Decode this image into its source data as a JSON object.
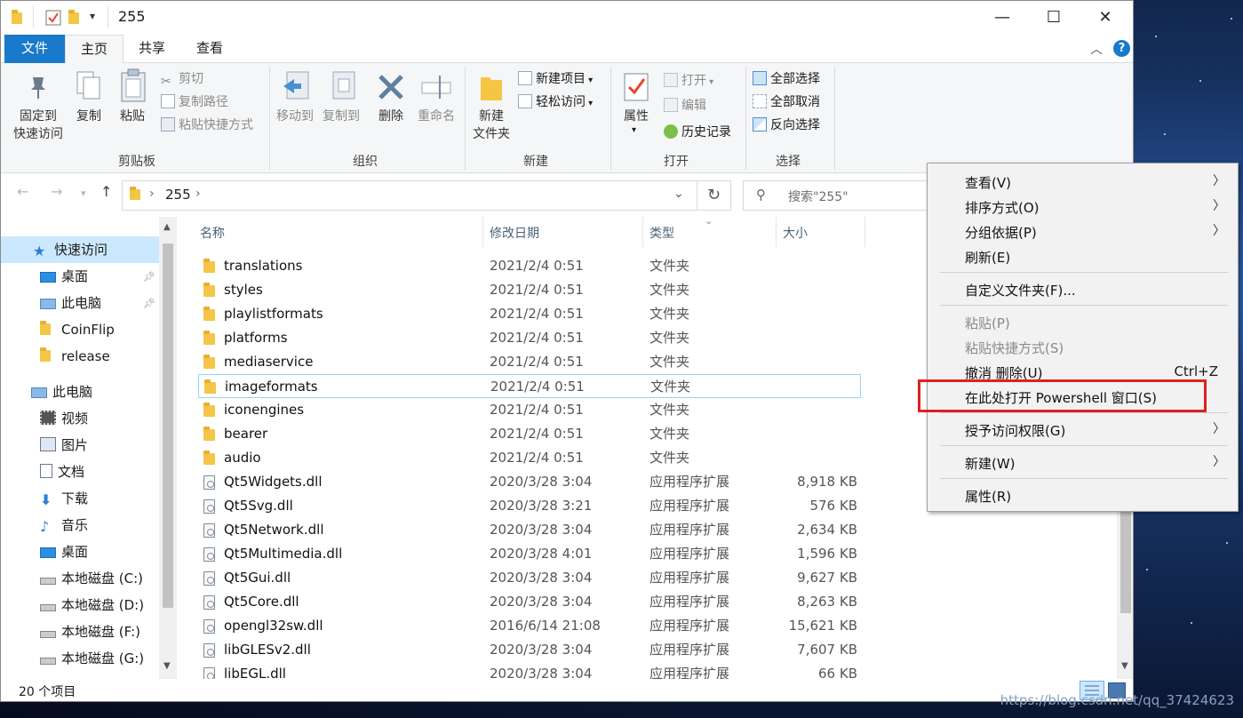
{
  "window": {
    "title": "255",
    "controls": {
      "minimize": "—",
      "maximize": "☐",
      "close": "✕"
    }
  },
  "ribbon": {
    "tabs": [
      "文件",
      "主页",
      "共享",
      "查看"
    ],
    "help_glyph": "?",
    "groups": {
      "clipboard": {
        "label": "剪贴板",
        "pin_label_1": "固定到",
        "pin_label_2": "快速访问",
        "copy_label": "复制",
        "paste_label": "粘贴",
        "cut_label": "剪切",
        "copy_path_label": "复制路径",
        "paste_shortcut_label": "粘贴快捷方式"
      },
      "organize": {
        "label": "组织",
        "move_to_label": "移动到",
        "copy_to_label": "复制到",
        "delete_label": "删除",
        "rename_label": "重命名"
      },
      "new": {
        "label": "新建",
        "new_folder_label_1": "新建",
        "new_folder_label_2": "文件夹",
        "new_item_label": "新建项目",
        "easy_access_label": "轻松访问"
      },
      "open": {
        "label": "打开",
        "properties_label": "属性",
        "open_label": "打开",
        "edit_label": "编辑",
        "history_label": "历史记录"
      },
      "select": {
        "label": "选择",
        "select_all_label": "全部选择",
        "select_none_label": "全部取消",
        "invert_label": "反向选择"
      }
    }
  },
  "address": {
    "path": [
      "255"
    ],
    "search_placeholder": "搜索\"255\""
  },
  "nav": {
    "items": [
      {
        "label": "快速访问",
        "icon": "star-icon"
      },
      {
        "label": "桌面",
        "icon": "desktop-icon"
      },
      {
        "label": "此电脑",
        "icon": "computer-icon"
      },
      {
        "label": "CoinFlip",
        "icon": "folder-icon"
      },
      {
        "label": "release",
        "icon": "folder-icon"
      },
      {
        "label": "此电脑",
        "icon": "computer-icon"
      },
      {
        "label": "视频",
        "icon": "video-icon"
      },
      {
        "label": "图片",
        "icon": "picture-icon"
      },
      {
        "label": "文档",
        "icon": "document-icon"
      },
      {
        "label": "下载",
        "icon": "download-icon"
      },
      {
        "label": "音乐",
        "icon": "music-icon"
      },
      {
        "label": "桌面",
        "icon": "desktop-icon"
      },
      {
        "label": "本地磁盘 (C:)",
        "icon": "drive-icon"
      },
      {
        "label": "本地磁盘 (D:)",
        "icon": "drive-icon"
      },
      {
        "label": "本地磁盘 (F:)",
        "icon": "drive-icon"
      },
      {
        "label": "本地磁盘 (G:)",
        "icon": "drive-icon"
      }
    ]
  },
  "list": {
    "columns": [
      "名称",
      "修改日期",
      "类型",
      "大小"
    ],
    "rows": [
      {
        "name": "translations",
        "date": "2021/2/4 0:51",
        "type": "文件夹",
        "size": ""
      },
      {
        "name": "styles",
        "date": "2021/2/4 0:51",
        "type": "文件夹",
        "size": ""
      },
      {
        "name": "playlistformats",
        "date": "2021/2/4 0:51",
        "type": "文件夹",
        "size": ""
      },
      {
        "name": "platforms",
        "date": "2021/2/4 0:51",
        "type": "文件夹",
        "size": ""
      },
      {
        "name": "mediaservice",
        "date": "2021/2/4 0:51",
        "type": "文件夹",
        "size": ""
      },
      {
        "name": "imageformats",
        "date": "2021/2/4 0:51",
        "type": "文件夹",
        "size": ""
      },
      {
        "name": "iconengines",
        "date": "2021/2/4 0:51",
        "type": "文件夹",
        "size": ""
      },
      {
        "name": "bearer",
        "date": "2021/2/4 0:51",
        "type": "文件夹",
        "size": ""
      },
      {
        "name": "audio",
        "date": "2021/2/4 0:51",
        "type": "文件夹",
        "size": ""
      },
      {
        "name": "Qt5Widgets.dll",
        "date": "2020/3/28 3:04",
        "type": "应用程序扩展",
        "size": "8,918 KB"
      },
      {
        "name": "Qt5Svg.dll",
        "date": "2020/3/28 3:21",
        "type": "应用程序扩展",
        "size": "576 KB"
      },
      {
        "name": "Qt5Network.dll",
        "date": "2020/3/28 3:04",
        "type": "应用程序扩展",
        "size": "2,634 KB"
      },
      {
        "name": "Qt5Multimedia.dll",
        "date": "2020/3/28 4:01",
        "type": "应用程序扩展",
        "size": "1,596 KB"
      },
      {
        "name": "Qt5Gui.dll",
        "date": "2020/3/28 3:04",
        "type": "应用程序扩展",
        "size": "9,627 KB"
      },
      {
        "name": "Qt5Core.dll",
        "date": "2020/3/28 3:04",
        "type": "应用程序扩展",
        "size": "8,263 KB"
      },
      {
        "name": "opengl32sw.dll",
        "date": "2016/6/14 21:08",
        "type": "应用程序扩展",
        "size": "15,621 KB"
      },
      {
        "name": "libGLESv2.dll",
        "date": "2020/3/28 3:04",
        "type": "应用程序扩展",
        "size": "7,607 KB"
      },
      {
        "name": "libEGL.dll",
        "date": "2020/3/28 3:04",
        "type": "应用程序扩展",
        "size": "66 KB"
      }
    ],
    "selected_index": 5
  },
  "status": {
    "count": "20 个项目"
  },
  "context_menu": {
    "items": [
      {
        "label": "查看(V)",
        "submenu": true,
        "disabled": false
      },
      {
        "label": "排序方式(O)",
        "submenu": true,
        "disabled": false
      },
      {
        "label": "分组依据(P)",
        "submenu": true,
        "disabled": false
      },
      {
        "label": "刷新(E)",
        "submenu": false,
        "disabled": false
      },
      {
        "label": "自定义文件夹(F)...",
        "submenu": false,
        "disabled": false
      },
      {
        "label": "粘贴(P)",
        "submenu": false,
        "disabled": true
      },
      {
        "label": "粘贴快捷方式(S)",
        "submenu": false,
        "disabled": true
      },
      {
        "label": "撤消 删除(U)",
        "shortcut": "Ctrl+Z",
        "submenu": false,
        "disabled": false
      },
      {
        "label": "在此处打开 Powershell 窗口(S)",
        "submenu": false,
        "disabled": false,
        "highlighted": true
      },
      {
        "label": "授予访问权限(G)",
        "submenu": true,
        "disabled": false
      },
      {
        "label": "新建(W)",
        "submenu": true,
        "disabled": false
      },
      {
        "label": "属性(R)",
        "submenu": false,
        "disabled": false
      }
    ]
  },
  "watermark": "https://blog.csdn.net/qq_37424623",
  "colors": {
    "file_tab": "#1979ca",
    "highlight_border": "#e0201f",
    "selection_border": "#99d1ff",
    "folder": "#f5c646"
  }
}
